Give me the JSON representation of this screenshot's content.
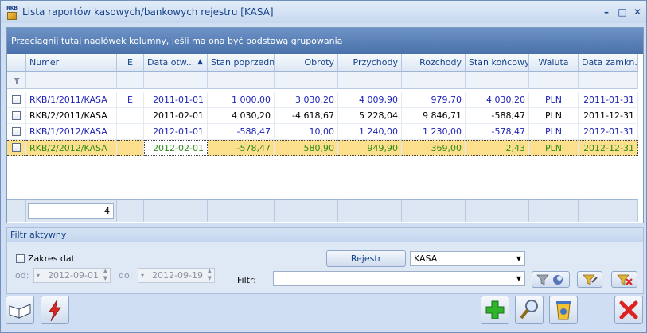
{
  "window": {
    "title": "Lista raportów kasowych/bankowych rejestru [KASA]",
    "logo_text": "RKB",
    "minimize": "–",
    "maximize": "□",
    "close": "✕"
  },
  "grid": {
    "group_hint": "Przeciągnij tutaj nagłówek kolumny, jeśli ma ona być podstawą grupowania",
    "columns": [
      "Numer",
      "E",
      "Data otw...",
      "Stan poprzedni",
      "Obroty",
      "Przychody",
      "Rozchody",
      "Stan końcowy",
      "Waluta",
      "Data zamkn."
    ],
    "sort_indicator": "▲",
    "rows": [
      {
        "numer": "RKB/1/2011/KASA",
        "e": "E",
        "data_otw": "2011-01-01",
        "stan_poprzedni": "1 000,00",
        "obroty": "3 030,20",
        "przychody": "4 009,90",
        "rozchody": "979,70",
        "stan_koncowy": "4 030,20",
        "waluta": "PLN",
        "data_zamkn": "2011-01-31"
      },
      {
        "numer": "RKB/2/2011/KASA",
        "e": "",
        "data_otw": "2011-02-01",
        "stan_poprzedni": "4 030,20",
        "obroty": "-4 618,67",
        "przychody": "5 228,04",
        "rozchody": "9 846,71",
        "stan_koncowy": "-588,47",
        "waluta": "PLN",
        "data_zamkn": "2011-12-31"
      },
      {
        "numer": "RKB/1/2012/KASA",
        "e": "",
        "data_otw": "2012-01-01",
        "stan_poprzedni": "-588,47",
        "obroty": "10,00",
        "przychody": "1 240,00",
        "rozchody": "1 230,00",
        "stan_koncowy": "-578,47",
        "waluta": "PLN",
        "data_zamkn": "2012-01-31"
      },
      {
        "numer": "RKB/2/2012/KASA",
        "e": "",
        "data_otw": "2012-02-01",
        "stan_poprzedni": "-578,47",
        "obroty": "580,90",
        "przychody": "949,90",
        "rozchody": "369,00",
        "stan_koncowy": "2,43",
        "waluta": "PLN",
        "data_zamkn": "2012-12-31"
      }
    ],
    "footer_count": "4"
  },
  "filter": {
    "title": "Filtr aktywny",
    "zakres_dat_label": "Zakres dat",
    "od_label": "od:",
    "od_value": "2012-09-01",
    "do_label": "do:",
    "do_value": "2012-09-19",
    "rejestr_button": "Rejestr",
    "rejestr_value": "KASA",
    "filtr_label": "Filtr:",
    "filtr_value": ""
  },
  "colors": {
    "blue_row": "#1b1fb5",
    "green_row": "#2e8a18",
    "selected_bg": "#fbdf8c"
  }
}
